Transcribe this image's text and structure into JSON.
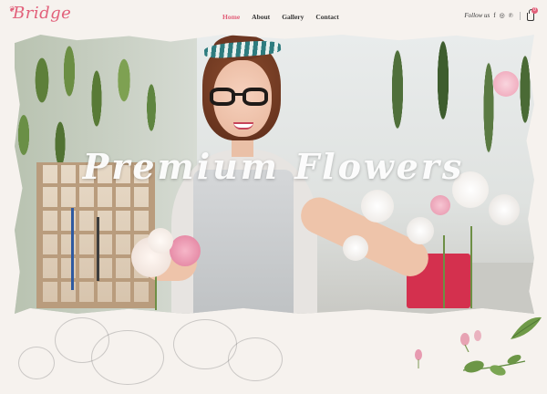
{
  "brand": {
    "logo_text": "Bridge"
  },
  "nav": {
    "items": [
      {
        "label": "Home",
        "active": true
      },
      {
        "label": "About",
        "active": false
      },
      {
        "label": "Gallery",
        "active": false
      },
      {
        "label": "Contact",
        "active": false
      }
    ]
  },
  "social": {
    "follow_label": "Follow us",
    "icons": [
      "facebook-icon",
      "instagram-icon",
      "pinterest-icon"
    ]
  },
  "cart": {
    "count": "0"
  },
  "hero": {
    "title": "Premium Flowers"
  },
  "colors": {
    "accent": "#e2607a",
    "background": "#f6f2ee",
    "nav_text": "#333333"
  }
}
